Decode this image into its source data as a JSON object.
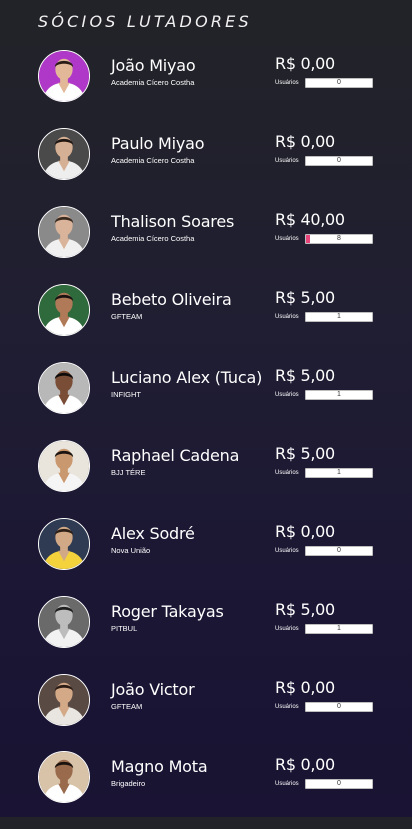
{
  "section_title": "SÓCIOS LUTADORES",
  "users_label": "Usuários",
  "colors": {
    "bar_fill": "#e8437a",
    "background_top": "#222328",
    "background_bottom": "#1a1333"
  },
  "fighters": [
    {
      "name": "João Miyao",
      "team": "Academia Cícero Costha",
      "price": "R$ 0,00",
      "users": "0",
      "fill_ratio": 0,
      "avatar_bg": "#b038c8",
      "skin": "#e2b898",
      "hair": "#2a1d18",
      "gi": "#ffffff"
    },
    {
      "name": "Paulo Miyao",
      "team": "Academia Cícero Costha",
      "price": "R$ 0,00",
      "users": "0",
      "fill_ratio": 0,
      "avatar_bg": "#4a4a4a",
      "skin": "#d6b094",
      "hair": "#201612",
      "gi": "#eeeeee"
    },
    {
      "name": "Thalison Soares",
      "team": "Academia Cícero Costha",
      "price": "R$ 40,00",
      "users": "8",
      "fill_ratio": 0.06,
      "avatar_bg": "#8a8a8a",
      "skin": "#d9b49a",
      "hair": "#3b2a20",
      "gi": "#f0f0f0"
    },
    {
      "name": "Bebeto Oliveira",
      "team": "GFTEAM",
      "price": "R$ 5,00",
      "users": "1",
      "fill_ratio": 0,
      "avatar_bg": "#2f6a3c",
      "skin": "#b07a58",
      "hair": "#1a1210",
      "gi": "#ffffff"
    },
    {
      "name": "Luciano Alex (Tuca)",
      "team": "INFIGHT",
      "price": "R$ 5,00",
      "users": "1",
      "fill_ratio": 0,
      "avatar_bg": "#b8b8b8",
      "skin": "#7a4d36",
      "hair": "#0f0b0a",
      "gi": "#ffffff"
    },
    {
      "name": "Raphael Cadena",
      "team": "BJJ TÉRE",
      "price": "R$ 5,00",
      "users": "1",
      "fill_ratio": 0,
      "avatar_bg": "#e9e4dc",
      "skin": "#c9986f",
      "hair": "#1b1410",
      "gi": "#f5f5f5"
    },
    {
      "name": "Alex Sodré",
      "team": "Nova União",
      "price": "R$ 0,00",
      "users": "0",
      "fill_ratio": 0,
      "avatar_bg": "#2e3b52",
      "skin": "#d2a987",
      "hair": "#2c1f18",
      "gi": "#f3d23c"
    },
    {
      "name": "Roger Takayas",
      "team": "PITBUL",
      "price": "R$ 5,00",
      "users": "1",
      "fill_ratio": 0,
      "avatar_bg": "#6a6a6a",
      "skin": "#bdbdbd",
      "hair": "#1e1e1e",
      "gi": "#f2f2f2"
    },
    {
      "name": "João Victor",
      "team": "GFTEAM",
      "price": "R$ 0,00",
      "users": "0",
      "fill_ratio": 0,
      "avatar_bg": "#5a4a44",
      "skin": "#d4a988",
      "hair": "#2b1d15",
      "gi": "#e9e6e2"
    },
    {
      "name": "Magno Mota",
      "team": "Brigadeiro",
      "price": "R$ 0,00",
      "users": "0",
      "fill_ratio": 0,
      "avatar_bg": "#d8c2a8",
      "skin": "#9a6a4c",
      "hair": "#1a120e",
      "gi": "#ffffff"
    }
  ]
}
